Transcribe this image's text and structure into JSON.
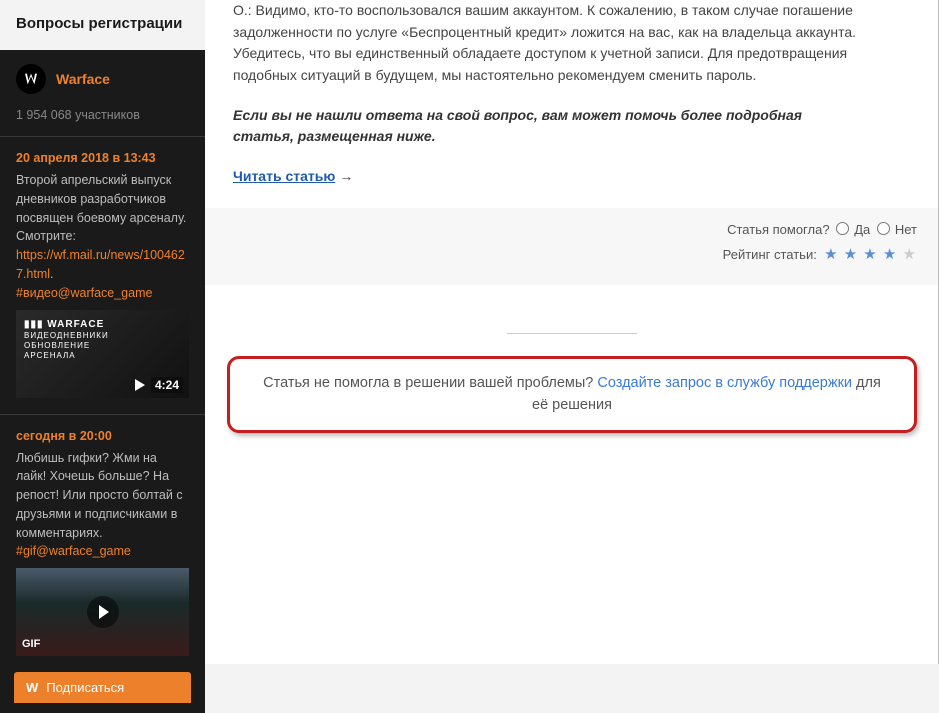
{
  "sidebar": {
    "title": "Вопросы регистрации",
    "widget_name": "Warface",
    "subscribers": "1 954 068 участников",
    "posts": [
      {
        "date": "20 апреля 2018 в 13:43",
        "text": "Второй апрельский выпуск дневников разработчиков посвящен боевому арсеналу. Смотрите: ",
        "link": "https://wf.mail.ru/news/1004627.html",
        "tag": "#видео@warface_game",
        "video": {
          "overlay_top": "WARFACE",
          "overlay_sub1": "ВИДЕОДНЕВНИКИ",
          "overlay_sub2": "ОБНОВЛЕНИЕ",
          "overlay_sub3": "АРСЕНАЛА",
          "duration": "4:24"
        }
      },
      {
        "date": "сегодня в 20:00",
        "text": "Любишь гифки? Жми на лайк! Хочешь больше? На репост! Или просто болтай с друзьями и подписчиками в комментариях.",
        "tag": "#gif@warface_game",
        "gif_label": "GIF"
      }
    ],
    "subscribe_label": "Подписаться"
  },
  "article": {
    "p1": "О.: Видимо, кто-то воспользовался вашим аккаунтом. К сожалению, в таком случае погашение задолженности по услуге «Беспроцентный кредит» ложится на вас, как на владельца аккаунта. Убедитесь, что вы единственный обладаете доступом к учетной записи. Для предотвращения подобных ситуаций в будущем, мы настоятельно рекомендуем сменить пароль.",
    "p2": "Если вы не нашли ответа на свой вопрос, вам может помочь более подробная статья, размещенная ниже.",
    "read_more": "Читать статью",
    "read_arrow": "→"
  },
  "feedback": {
    "helped_label": "Статья помогла?",
    "yes": "Да",
    "no": "Нет",
    "rating_label": "Рейтинг статьи:"
  },
  "callout": {
    "text_before": "Статья не помогла в решении вашей проблемы? ",
    "link": "Создайте запрос в службу поддержки",
    "text_after": " для её решения"
  }
}
